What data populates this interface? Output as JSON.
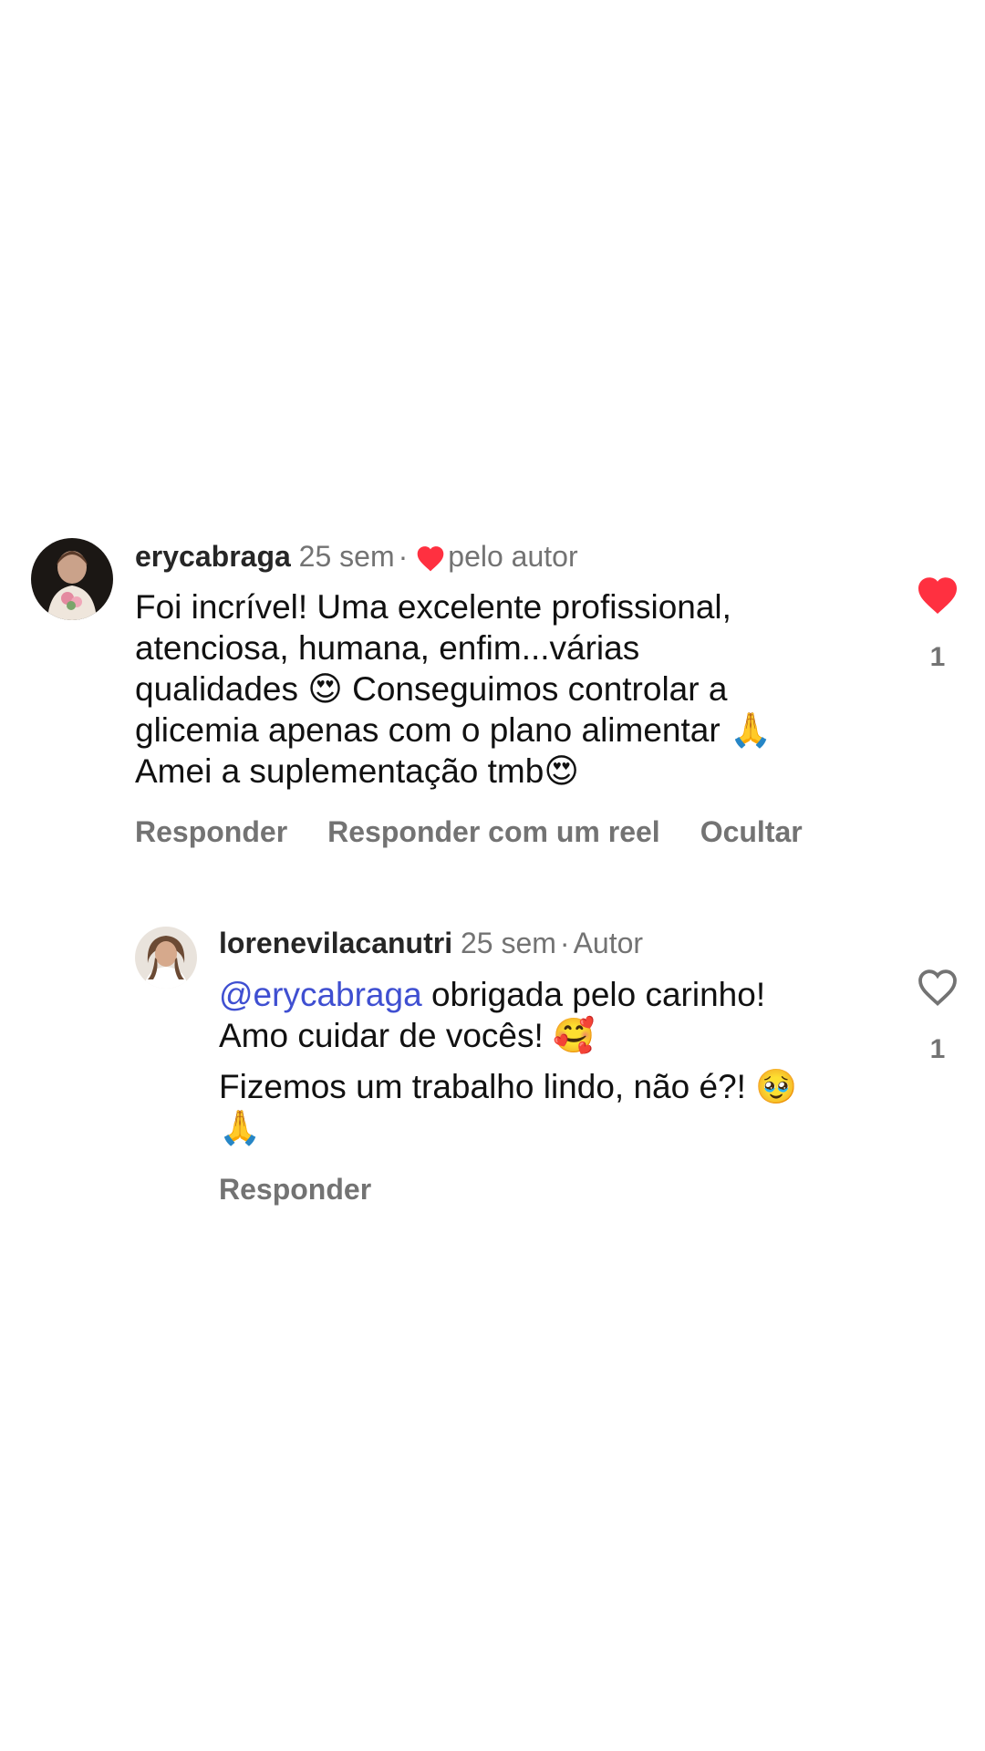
{
  "colors": {
    "like_red": "#ff3040",
    "mention_blue": "#3f4fd1",
    "meta_gray": "#737373",
    "text": "#111111"
  },
  "comment": {
    "username": "erycabraga",
    "time": "25 sem",
    "separator": "·",
    "liked_by_author_icon": "filled-heart-icon",
    "liked_by_author_label": "pelo autor",
    "lines": [
      "Foi incrível! Uma excelente profissional,",
      "atenciosa,  humana, enfim...várias",
      "qualidades 😍 Conseguimos controlar a",
      "glicemia apenas com o plano alimentar 🙏",
      "Amei a suplementação tmb😍"
    ],
    "actions": {
      "reply": "Responder",
      "reply_with_reel": "Responder com um reel",
      "hide": "Ocultar"
    },
    "like_icon": "filled-heart-icon",
    "liked": true,
    "like_count": "1"
  },
  "reply": {
    "username": "lorenevilacanutri",
    "time": "25 sem",
    "separator": "·",
    "author_label": "Autor",
    "mention": "@erycabraga",
    "lines": [
      " obrigada pelo carinho!",
      "Amo cuidar de vocês! 🥰",
      "Fizemos um trabalho lindo, não é?! 🥹",
      "🙏"
    ],
    "actions": {
      "reply": "Responder"
    },
    "like_icon": "outline-heart-icon",
    "liked": false,
    "like_count": "1"
  }
}
